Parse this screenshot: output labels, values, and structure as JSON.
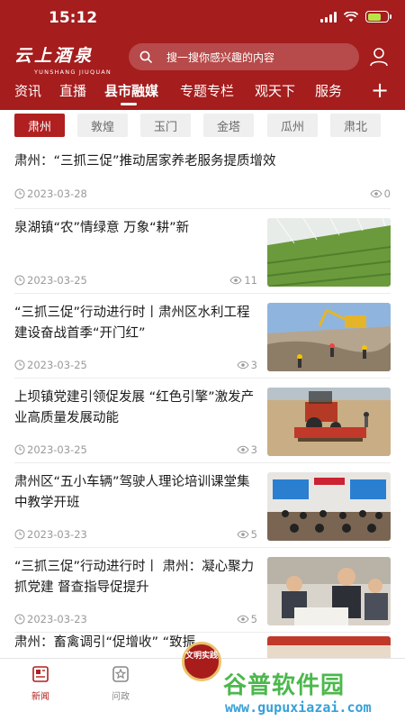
{
  "status": {
    "time": "15:12"
  },
  "brand": {
    "name_cn": "云上酒泉",
    "name_en": "YUNSHANG JIUQUAN"
  },
  "search": {
    "placeholder": "搜一搜你感兴趣的内容"
  },
  "nav": {
    "tabs": [
      "资讯",
      "直播",
      "县市融媒",
      "专题专栏",
      "观天下",
      "服务"
    ],
    "active_index": 2,
    "more_label": "+"
  },
  "sub_tabs": {
    "items": [
      "肃州",
      "敦煌",
      "玉门",
      "金塔",
      "瓜州",
      "肃北"
    ],
    "active_index": 0
  },
  "articles": [
    {
      "title": "肃州：“三抓三促”推动居家养老服务提质增效",
      "date": "2023-03-28",
      "views": "0",
      "has_image": false
    },
    {
      "title": "泉湖镇“农”情绿意 万象“耕”新",
      "date": "2023-03-25",
      "views": "11",
      "has_image": true,
      "image": "greenhouse-photo"
    },
    {
      "title": "“三抓三促”行动进行时丨肃州区水利工程建设奋战首季“开门红”",
      "date": "2023-03-25",
      "views": "3",
      "has_image": true,
      "image": "construction-photo"
    },
    {
      "title": "上坝镇党建引领促发展 “红色引擎”激发产业高质量发展动能",
      "date": "2023-03-25",
      "views": "3",
      "has_image": true,
      "image": "tractor-photo"
    },
    {
      "title": "肃州区“五小车辆”驾驶人理论培训课堂集中教学开班",
      "date": "2023-03-23",
      "views": "5",
      "has_image": true,
      "image": "classroom-photo"
    },
    {
      "title": "“三抓三促”行动进行时丨 肃州：凝心聚力抓党建 督查指导促提升",
      "date": "2023-03-23",
      "views": "5",
      "has_image": true,
      "image": "meeting-photo"
    },
    {
      "title": "肃州：畜禽调引“促增收”  “致振",
      "date": "",
      "views": "",
      "has_image": true,
      "image": "partial-photo"
    }
  ],
  "bottom_nav": {
    "items": [
      {
        "label": "新闻",
        "icon": "newspaper-icon",
        "active": true
      },
      {
        "label": "问政",
        "icon": "star-box-icon",
        "active": false
      }
    ],
    "center_badge": "文明实践"
  },
  "watermark": {
    "main": "谷普软件园",
    "sub": "www.gupuxiazai.com"
  },
  "colors": {
    "brand_red": "#a51d1d",
    "active_tab": "#b02020",
    "meta_gray": "#9a9a9a",
    "watermark_green": "#4cb84c",
    "watermark_blue": "#38a0d8"
  }
}
